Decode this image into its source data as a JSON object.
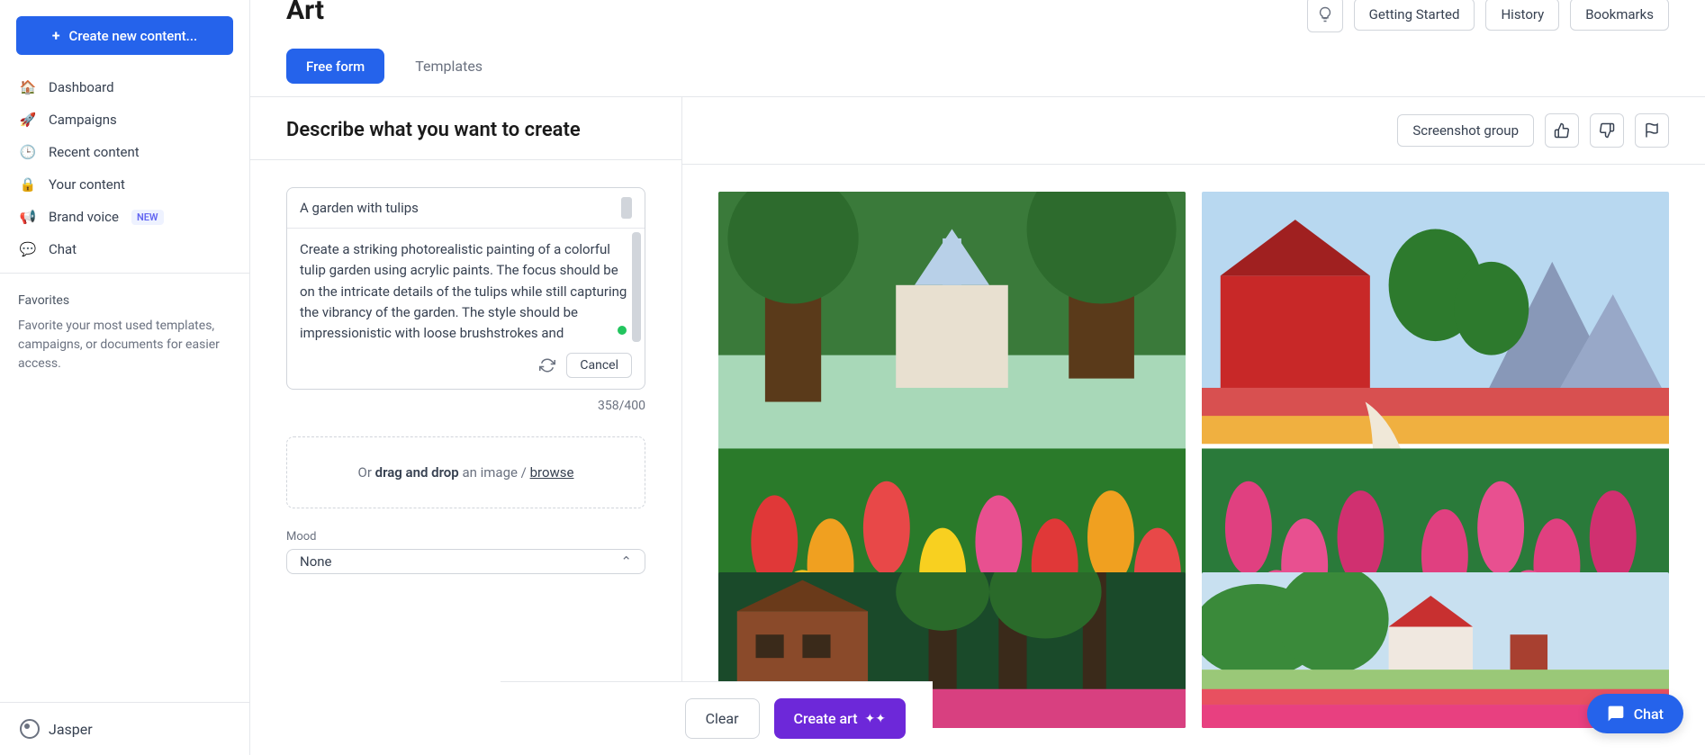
{
  "page_title": "Art",
  "sidebar": {
    "create_label": "Create new content...",
    "items": [
      {
        "icon": "🏠",
        "label": "Dashboard"
      },
      {
        "icon": "🚀",
        "label": "Campaigns"
      },
      {
        "icon": "🕒",
        "label": "Recent content"
      },
      {
        "icon": "🔒",
        "label": "Your content"
      },
      {
        "icon": "📢",
        "label": "Brand voice",
        "badge": "NEW"
      },
      {
        "icon": "💬",
        "label": "Chat"
      }
    ],
    "favorites_title": "Favorites",
    "favorites_text": "Favorite your most used templates, campaigns, or documents for easier access.",
    "logo_label": "Jasper"
  },
  "top_actions": {
    "getting_started": "Getting Started",
    "history": "History",
    "bookmarks": "Bookmarks"
  },
  "tabs": {
    "free_form": "Free form",
    "templates": "Templates"
  },
  "form": {
    "heading": "Describe what you want to create",
    "title": "A garden with tulips",
    "body": "Create a striking photorealistic painting of a colorful tulip garden using acrylic paints. The focus should be on the intricate details of the tulips while still capturing the vibrancy of the garden. The style should be impressionistic with loose brushstrokes and contrasting color combinations. The scene should be set in the early morning or late afternoon",
    "cancel": "Cancel",
    "char_count": "358/400",
    "drop_prefix": "Or ",
    "drop_bold": "drag and drop",
    "drop_mid": " an image / ",
    "drop_link": "browse",
    "mood_label": "Mood",
    "mood_value": "None"
  },
  "actions": {
    "clear": "Clear",
    "create_art": "Create art"
  },
  "results": {
    "group_label": "Screenshot group"
  },
  "chat_label": "Chat"
}
